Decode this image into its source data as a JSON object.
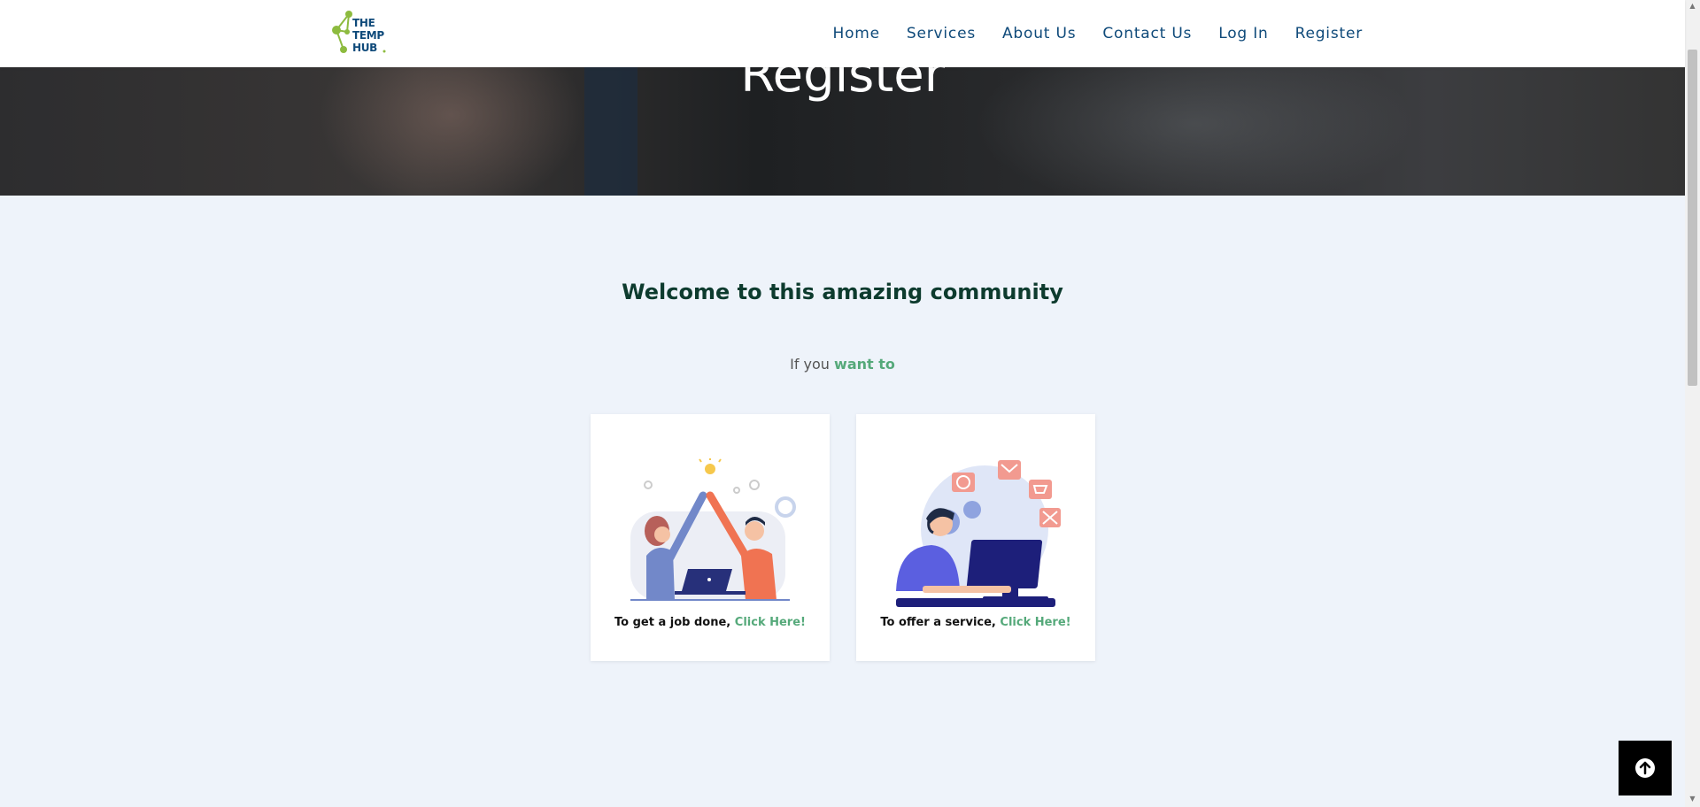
{
  "header": {
    "logo_lines": [
      "THE",
      "TEMP",
      "HUB"
    ],
    "nav": [
      {
        "label": "Home"
      },
      {
        "label": "Services"
      },
      {
        "label": "About Us"
      },
      {
        "label": "Contact Us"
      },
      {
        "label": "Log In"
      },
      {
        "label": "Register"
      }
    ]
  },
  "hero": {
    "title": "Register"
  },
  "main": {
    "welcome": "Welcome to this amazing community",
    "ifyou_prefix": "If you",
    "ifyou_highlight": "want to",
    "cards": [
      {
        "caption": "To get a job done,",
        "link": "Click Here!",
        "illustration": "high-five-illustration"
      },
      {
        "caption": "To offer a service,",
        "link": "Click Here!",
        "illustration": "support-agent-illustration"
      }
    ]
  },
  "colors": {
    "brand_navy": "#0f4a7a",
    "brand_green": "#55a97a",
    "heading_dark_green": "#0d3b2e",
    "page_bg": "#eef3fa"
  },
  "icons": {
    "back_to_top": "arrow-up-circle-icon"
  }
}
